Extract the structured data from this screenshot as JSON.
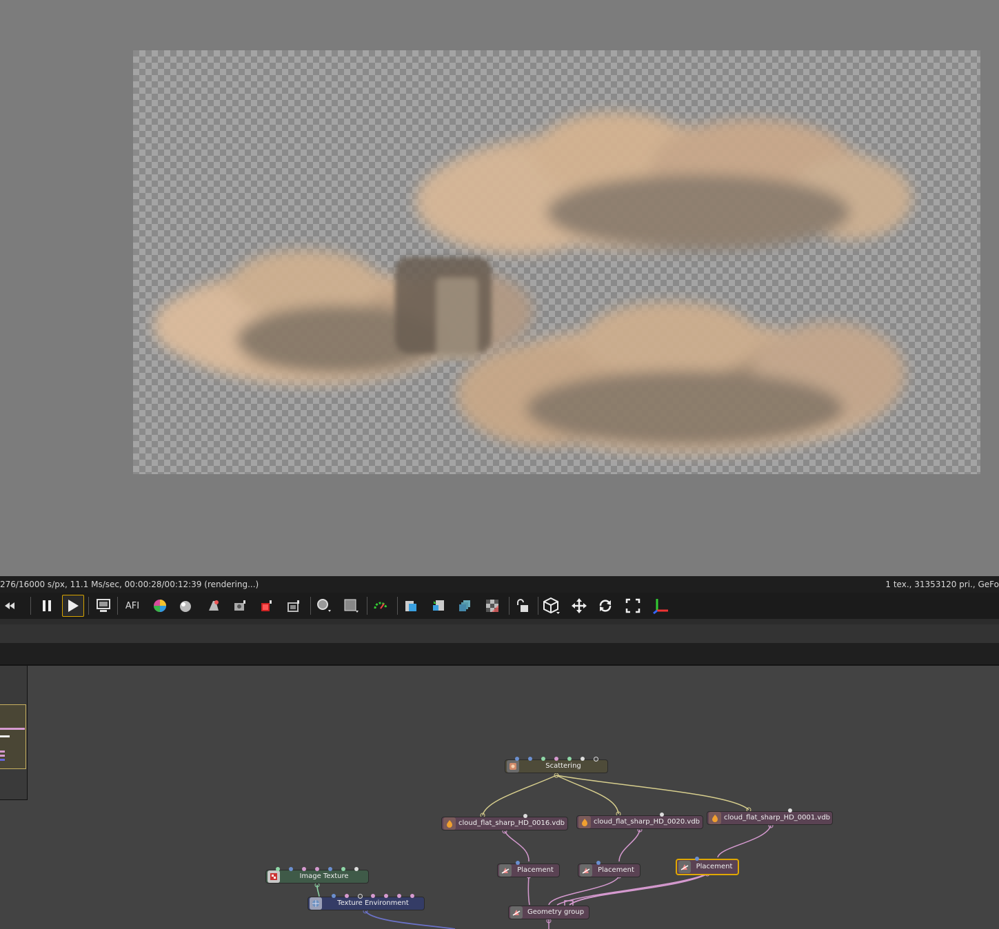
{
  "status": {
    "left": "276/16000 s/px, 11.1 Ms/sec, 00:00:28/00:12:39 (rendering...)",
    "right": "1 tex., 31353120 pri., GeFo"
  },
  "toolbar_icons": [
    "rewind-icon",
    "pause-icon",
    "play-icon",
    "display-icon",
    "afi-icon",
    "color-wheel-icon",
    "material-ball-icon",
    "paint-icon",
    "camera-icon",
    "red-square-icon",
    "render-region-icon",
    "picker-icon",
    "film-region-icon",
    "motion-blur-icon",
    "copy-icon",
    "paste-icon",
    "layers-icon",
    "checker-icon",
    "lock-icon",
    "cube-icon",
    "move-icon",
    "rotate-icon",
    "fit-icon",
    "axis-icon"
  ],
  "toolbar": {
    "afi_label": "AFI"
  },
  "nodes": {
    "scattering": {
      "label": "Scattering",
      "color": "#4e4b39"
    },
    "vdb_0016": {
      "label": "cloud_flat_sharp_HD_0016.vdb",
      "color": "#5a4253"
    },
    "vdb_0020": {
      "label": "cloud_flat_sharp_HD_0020.vdb",
      "color": "#5a4253"
    },
    "vdb_0001": {
      "label": "cloud_flat_sharp_HD_0001.vdb",
      "color": "#5a4253"
    },
    "placement_1": {
      "label": "Placement",
      "color": "#5a4253"
    },
    "placement_2": {
      "label": "Placement",
      "color": "#5a4253"
    },
    "placement_3": {
      "label": "Placement",
      "color": "#5a4253"
    },
    "geometry_group": {
      "label": "Geometry group",
      "color": "#5a4253"
    },
    "image_texture": {
      "label": "Image Texture",
      "color": "#3f5a48"
    },
    "texture_environment": {
      "label": "Texture Environment",
      "color": "#343c66"
    }
  },
  "colors": {
    "geometry_wire": "#d69ad0",
    "scatter_wire": "#d8cf8e",
    "env_wire": "#6b72c8",
    "selection": "#e0a800"
  }
}
